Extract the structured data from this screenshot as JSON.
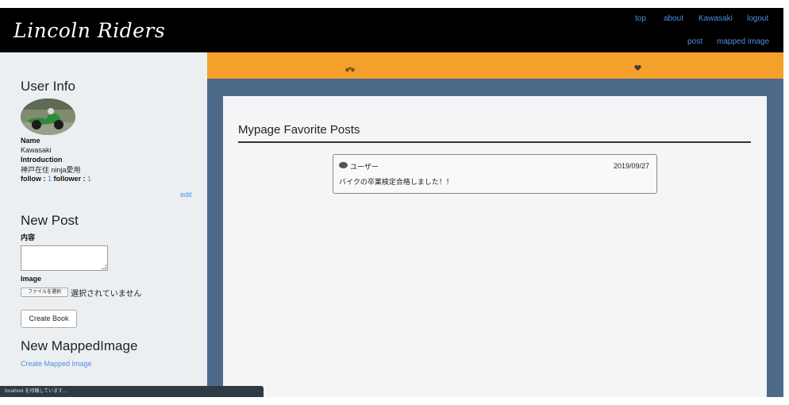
{
  "header": {
    "brand": "Lincoln Riders",
    "nav": [
      {
        "label": "top"
      },
      {
        "label": "about"
      },
      {
        "label": "Kawasaki"
      },
      {
        "label": "logout"
      },
      {
        "label": "post"
      },
      {
        "label": "mapped image"
      }
    ]
  },
  "tabs": [
    {
      "icon": "motorcycle-icon"
    },
    {
      "icon": "heart-icon"
    }
  ],
  "sidebar": {
    "user_info_heading": "User Info",
    "name_label": "Name",
    "name_value": "Kawasaki",
    "intro_label": "Introduction",
    "intro_value": "神戸在住 ninja愛用",
    "follow_label": "follow : ",
    "follow_count": "1",
    "follower_label": "follower : ",
    "follower_count": "1",
    "edit_link": "edit",
    "new_post_heading": "New Post",
    "content_label": "内容",
    "image_label": "Image",
    "file_button": "ファイルを選択",
    "file_status": "選択されていません",
    "create_button": "Create Book",
    "mapped_heading": "New MappedImage",
    "mapped_link": "Create Mapped Image"
  },
  "main": {
    "title": "Mypage Favorite Posts",
    "posts": [
      {
        "user": "ユーザー",
        "date": "2019/09/27",
        "body": "バイクの卒業検定合格しました！！"
      }
    ]
  },
  "status_bar": "localhost を待機しています...",
  "colors": {
    "header": "#000000",
    "accent": "#f5a02a",
    "link": "#4a90e2",
    "background": "#4e6a8a"
  }
}
